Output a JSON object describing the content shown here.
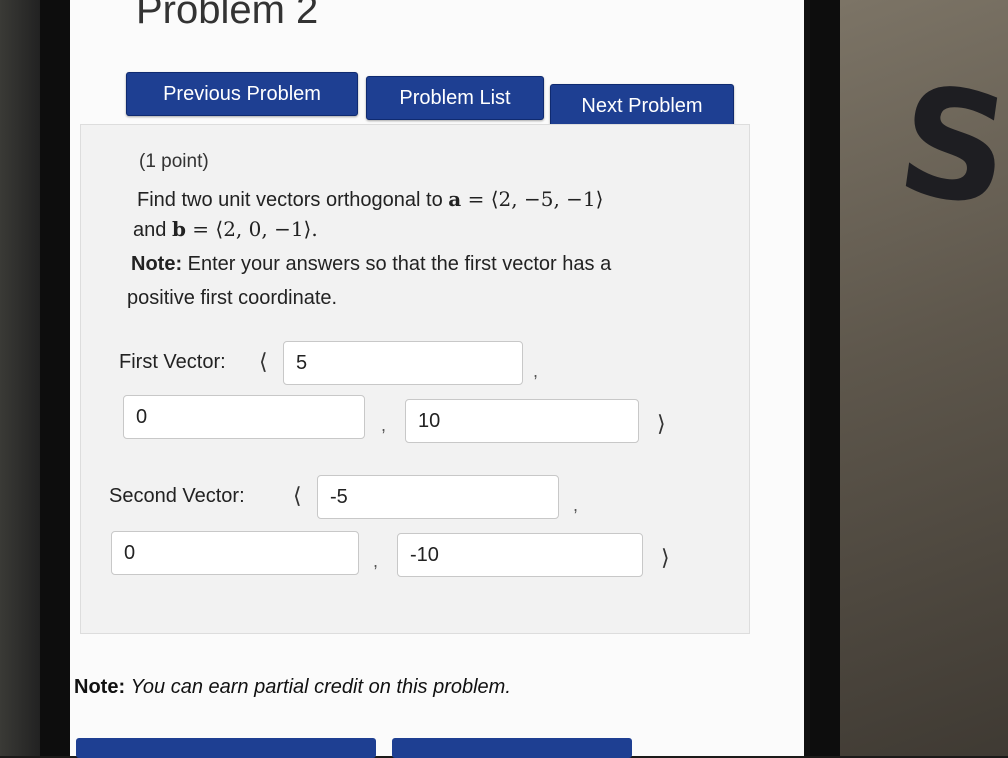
{
  "page": {
    "title": "Problem 2"
  },
  "nav": {
    "previous": "Previous Problem",
    "list": "Problem List",
    "next": "Next Problem"
  },
  "problem": {
    "points": "(1 point)",
    "line1": "Find two unit vectors orthogonal to",
    "a_name": "a",
    "a_value": " = ⟨2, −5, −1⟩",
    "and": "and",
    "b_name": "b",
    "b_value": " = ⟨2, 0, −1⟩.",
    "note_label": "Note:",
    "note_line1": " Enter your answers so that the first vector has a",
    "note_line2": "positive first coordinate."
  },
  "first_vector": {
    "label": "First Vector:",
    "open": "⟨",
    "c1": "5",
    "c2": "0",
    "c3": "10",
    "close": "⟩"
  },
  "second_vector": {
    "label": "Second Vector:",
    "open": "⟨",
    "c1": "-5",
    "c2": "0",
    "c3": "-10",
    "close": "⟩"
  },
  "comma": ",",
  "footer": {
    "note_label": "Note:",
    "note_text": "You can earn partial credit on this problem."
  },
  "background": {
    "letter": "S"
  }
}
